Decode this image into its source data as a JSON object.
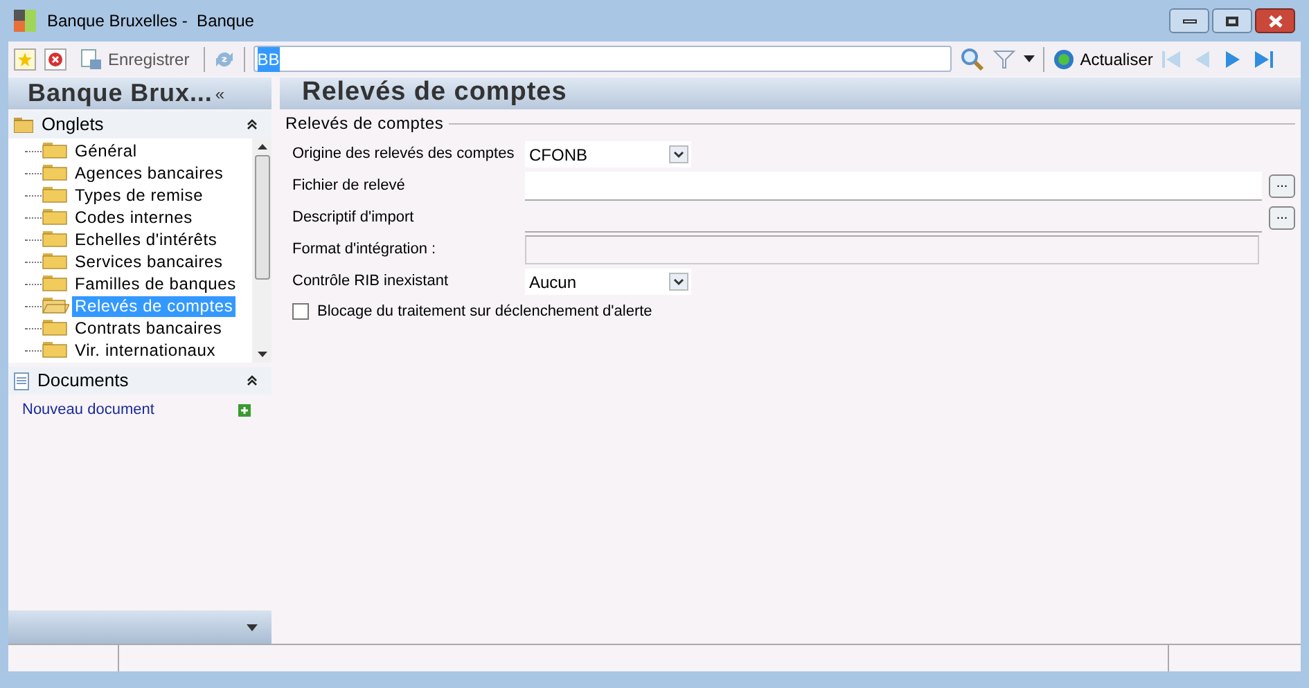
{
  "window": {
    "title": "Banque Bruxelles -  Banque"
  },
  "toolbar": {
    "save_label": "Enregistrer",
    "search_value": "BB",
    "refresh_label": "Actualiser"
  },
  "sidebar": {
    "title": "Banque Brux...",
    "collapse_glyph": "«",
    "tabs_header": "Onglets",
    "items": [
      {
        "label": "Général",
        "selected": false
      },
      {
        "label": "Agences bancaires",
        "selected": false
      },
      {
        "label": "Types de remise",
        "selected": false
      },
      {
        "label": "Codes internes",
        "selected": false
      },
      {
        "label": "Echelles d'intérêts",
        "selected": false
      },
      {
        "label": "Services bancaires",
        "selected": false
      },
      {
        "label": "Familles de banques",
        "selected": false
      },
      {
        "label": "Relevés de comptes",
        "selected": true
      },
      {
        "label": "Contrats bancaires",
        "selected": false
      },
      {
        "label": "Vir. internationaux",
        "selected": false
      }
    ],
    "documents_header": "Documents",
    "new_document": "Nouveau document"
  },
  "page": {
    "title": "Relevés de comptes",
    "group_title": "Relevés de comptes",
    "fields": [
      {
        "kind": "select",
        "label": "Origine des relevés des comptes",
        "value": "CFONB"
      },
      {
        "kind": "browse",
        "label": "Fichier de relevé",
        "browse": "..."
      },
      {
        "kind": "browse-bare",
        "label": "Descriptif d'import",
        "browse": "..."
      },
      {
        "kind": "text-disabled",
        "label": "Format d'intégration :"
      },
      {
        "kind": "select",
        "label": "Contrôle RIB inexistant",
        "value": "Aucun"
      }
    ],
    "checkbox": {
      "label": "Blocage du traitement sur déclenchement d'alerte",
      "checked": false
    }
  }
}
